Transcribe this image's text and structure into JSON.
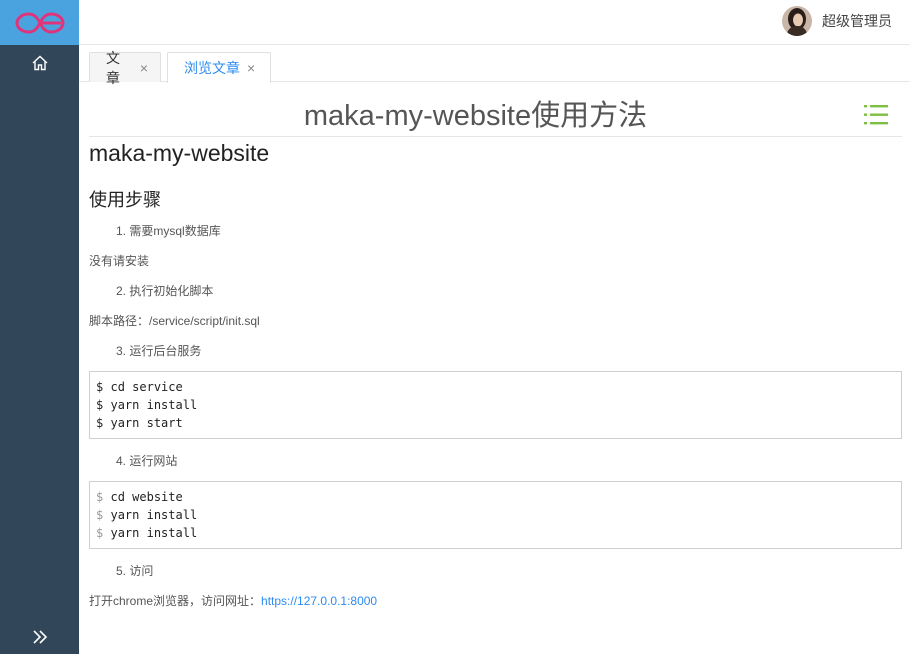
{
  "sidebar": {
    "logo_icon": "infinity-logo-icon",
    "home_icon": "home-icon",
    "collapse_icon": "double-chevron-right-icon",
    "colors": {
      "background": "#314659",
      "logo_background": "#4aa3df",
      "logo": "#e0347a"
    }
  },
  "header": {
    "user_name": "超级管理员",
    "avatar_icon": "user-avatar"
  },
  "tabs": [
    {
      "label": "文章",
      "close": "×",
      "active": false
    },
    {
      "label": "浏览文章",
      "close": "×",
      "active": true
    }
  ],
  "article": {
    "title": "maka-my-website使用方法",
    "toc_icon": "list-icon",
    "heading": "maka-my-website",
    "subheading": "使用步骤",
    "steps": [
      {
        "num": "1.",
        "text": "需要mysql数据库"
      },
      {
        "num": "2.",
        "text": "执行初始化脚本"
      },
      {
        "num": "3.",
        "text": "运行后台服务"
      },
      {
        "num": "4.",
        "text": "运行网站"
      },
      {
        "num": "5.",
        "text": "访问"
      }
    ],
    "para1": "没有请安装",
    "para2": "脚本路径：/service/script/init.sql",
    "code1": [
      {
        "prompt": "$",
        "cmd": "cd service"
      },
      {
        "prompt": "$",
        "cmd": "yarn install"
      },
      {
        "prompt": "$",
        "cmd": "yarn start"
      }
    ],
    "code2": [
      {
        "prompt": "$",
        "cmd": "cd website"
      },
      {
        "prompt": "$",
        "cmd": "yarn install"
      },
      {
        "prompt": "$",
        "cmd": "yarn install"
      }
    ],
    "para3_prefix": "打开chrome浏览器，访问网址：",
    "para3_link": "https://127.0.0.1:8000",
    "colors": {
      "accent": "#2d8cf0",
      "toc_icon": "#7bc043"
    }
  }
}
